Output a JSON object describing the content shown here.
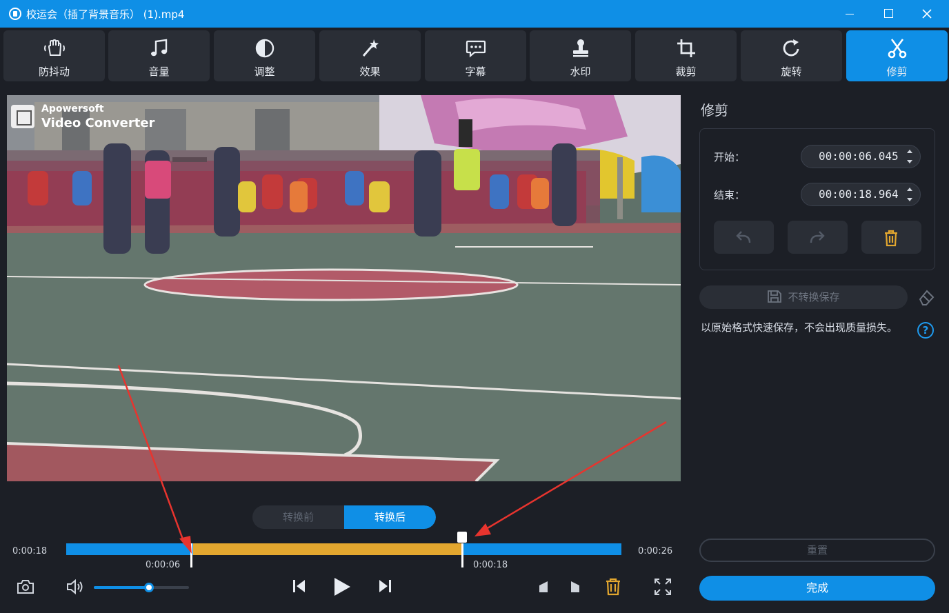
{
  "window": {
    "title": "校运会（插了背景音乐） (1).mp4"
  },
  "toolbar": {
    "tools": [
      {
        "label": "防抖动",
        "icon": "stabilize-hand-icon"
      },
      {
        "label": "音量",
        "icon": "music-note-icon"
      },
      {
        "label": "调整",
        "icon": "contrast-icon"
      },
      {
        "label": "效果",
        "icon": "magic-wand-icon"
      },
      {
        "label": "字幕",
        "icon": "speech-bubble-icon"
      },
      {
        "label": "水印",
        "icon": "stamp-icon"
      },
      {
        "label": "裁剪",
        "icon": "crop-icon"
      },
      {
        "label": "旋转",
        "icon": "rotate-icon"
      },
      {
        "label": "修剪",
        "icon": "scissors-icon"
      }
    ],
    "active": "修剪"
  },
  "watermark": {
    "line1": "Apowersoft",
    "line2": "Video Converter"
  },
  "panel": {
    "title": "修剪",
    "start_label": "开始：",
    "start_value": "00:00:06.045",
    "end_label": "结束：",
    "end_value": "00:00:18.964",
    "save_nc_label": "不转换保存",
    "hint": "以原始格式快速保存，不会出现质量损失。",
    "help": "?",
    "reset_label": "重置",
    "done_label": "完成"
  },
  "compare": {
    "before": "转换前",
    "after": "转换后"
  },
  "timeline": {
    "current_time": "0:00:18",
    "total_time": "0:00:26",
    "trim_start_label": "0:00:06",
    "trim_end_label": "0:00:18",
    "trim_start_fraction": 0.229,
    "trim_end_fraction": 0.714
  },
  "volume": {
    "level": 0.58
  },
  "colors": {
    "accent": "#0f8fe6",
    "trim": "#e3a72f",
    "background": "#1c1f26",
    "annotation_arrow": "#e8342e"
  }
}
